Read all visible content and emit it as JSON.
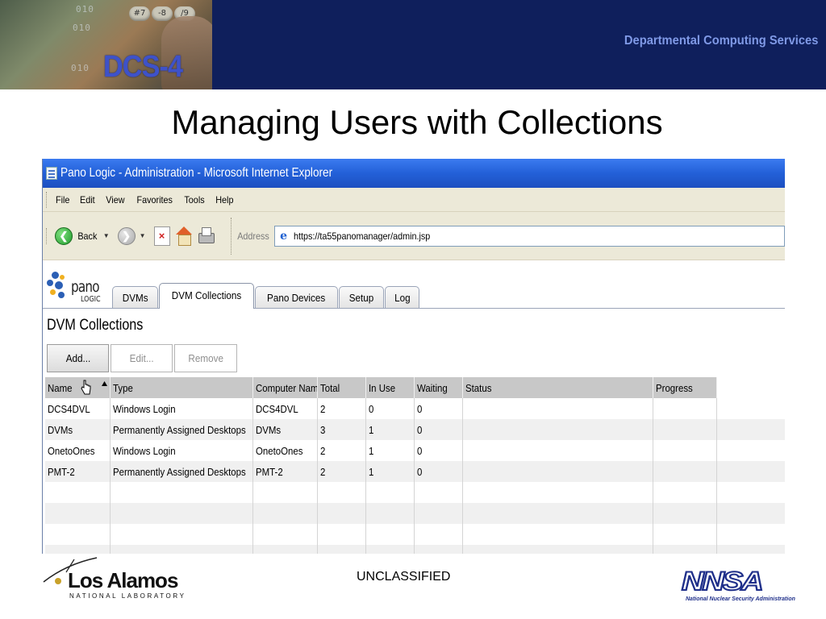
{
  "banner": {
    "logo_text": "DCS-4",
    "department": "Departmental Computing Services",
    "photo_digits": [
      "010",
      "010",
      "010"
    ],
    "keypad": [
      "#7",
      "-8",
      "/9"
    ]
  },
  "slide_title": "Managing Users with Collections",
  "browser": {
    "window_title": "Pano Logic - Administration - Microsoft Internet Explorer",
    "menu": [
      "File",
      "Edit",
      "View",
      "Favorites",
      "Tools",
      "Help"
    ],
    "toolbar": {
      "back_label": "Back",
      "address_label": "Address"
    },
    "address_url": "https://ta55panomanager/admin.jsp"
  },
  "app": {
    "logo_word": "pano",
    "logo_sub": "LOGIC",
    "tabs": [
      "DVMs",
      "DVM Collections",
      "Pano Devices",
      "Setup",
      "Log"
    ],
    "active_tab": "DVM Collections",
    "section_title": "DVM Collections",
    "buttons": {
      "add": "Add...",
      "edit": "Edit...",
      "remove": "Remove"
    },
    "columns": [
      "Name",
      "Type",
      "Computer Name",
      "Total",
      "In Use",
      "Waiting",
      "Status",
      "Progress"
    ],
    "rows": [
      {
        "name": "DCS4DVL",
        "type": "Windows Login",
        "computer": "DCS4DVL",
        "total": "2",
        "in_use": "0",
        "waiting": "0",
        "status": "",
        "progress": ""
      },
      {
        "name": "DVMs",
        "type": "Permanently Assigned Desktops",
        "computer": "DVMs",
        "total": "3",
        "in_use": "1",
        "waiting": "0",
        "status": "",
        "progress": ""
      },
      {
        "name": "OnetoOnes",
        "type": "Windows Login",
        "computer": "OnetoOnes",
        "total": "2",
        "in_use": "1",
        "waiting": "0",
        "status": "",
        "progress": ""
      },
      {
        "name": "PMT-2",
        "type": "Permanently Assigned Desktops",
        "computer": "PMT-2",
        "total": "2",
        "in_use": "1",
        "waiting": "0",
        "status": "",
        "progress": ""
      }
    ]
  },
  "footer": {
    "lanl_name": "Los Alamos",
    "lanl_sub": "NATIONAL LABORATORY",
    "classification": "UNCLASSIFIED",
    "nnsa_word": "NNSA",
    "nnsa_sub": "National Nuclear Security Administration"
  },
  "colors": {
    "banner_bg": "#0f1f5c",
    "dcs_blue": "#3e52c9",
    "dept_text": "#7f99e6",
    "ie_title_blue": "#2360d8",
    "grid_header": "#c8c8c8"
  }
}
